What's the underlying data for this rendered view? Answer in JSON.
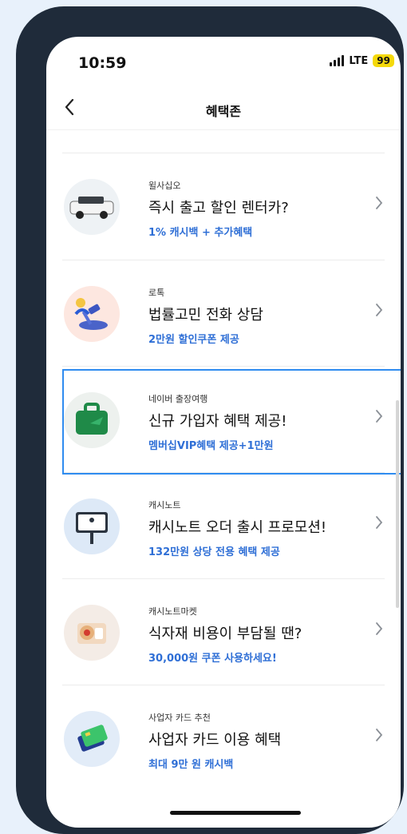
{
  "status": {
    "time": "10:59",
    "network": "LTE",
    "battery": "99"
  },
  "nav": {
    "title": "혜택존",
    "back_icon": "chevron-left-icon"
  },
  "items": [
    {
      "sub": "윌사십오",
      "head": "즉시 출고 할인 렌터카?",
      "benefit": "1% 캐시백 + 추가혜택",
      "icon": "car-icon"
    },
    {
      "sub": "로톡",
      "head": "법률고민 전화 상담",
      "benefit": "2만원 할인쿠폰 제공",
      "icon": "gavel-phone-icon"
    },
    {
      "sub": "네이버 출장여행",
      "head": "신규 가입자 혜택 제공!",
      "benefit": "멤버십VIP혜택 제공+1만원",
      "icon": "suitcase-icon"
    },
    {
      "sub": "캐시노트",
      "head": "캐시노트 오더 출시 프로모션!",
      "benefit": "132만원 상당 전용 혜택 제공",
      "icon": "signboard-icon"
    },
    {
      "sub": "캐시노트마켓",
      "head": "식자재 비용이 부담될 땐?",
      "benefit": "30,000원 쿠폰 사용하세요!",
      "icon": "food-box-icon"
    },
    {
      "sub": "사업자 카드 추천",
      "head": "사업자 카드 이용 혜택",
      "benefit": "최대 9만 원 캐시백",
      "icon": "credit-card-icon"
    }
  ],
  "colors": {
    "accent": "#2f6fd6",
    "highlight": "#2f8cf0",
    "frame": "#1f2b3a"
  }
}
